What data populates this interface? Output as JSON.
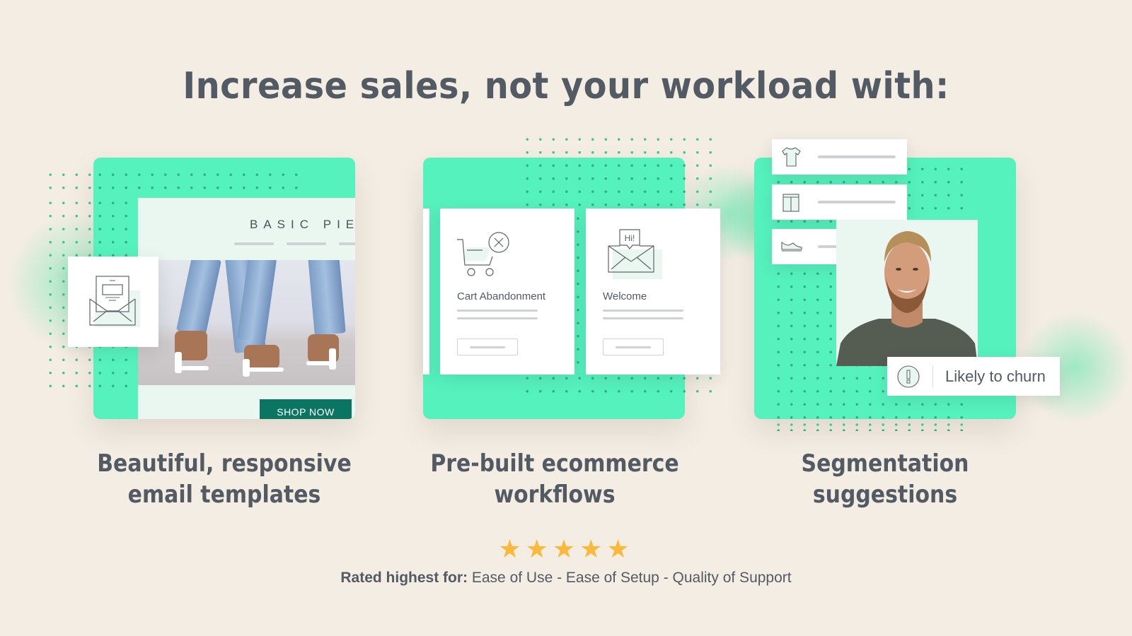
{
  "headline": "Increase sales, not your workload with:",
  "colors": {
    "background": "#f4ede3",
    "panel_green": "#55f2be",
    "text": "#525a64",
    "shop_button": "#0b7563",
    "star": "#fbb93c"
  },
  "features": [
    {
      "label_line1": "Beautiful, responsive",
      "label_line2": "email templates",
      "illustration": {
        "brand_text": "BASIC PIEC",
        "cta_label": "SHOP NOW",
        "icon": "open-envelope-icon"
      }
    },
    {
      "label_line1": "Pre-built ecommerce",
      "label_line2": "workflows",
      "illustration": {
        "cards": [
          {
            "title": "Cart Abandonment",
            "icon": "cart-remove-icon"
          },
          {
            "title": "Welcome",
            "icon": "envelope-hi-icon",
            "bubble": "Hi!"
          }
        ]
      }
    },
    {
      "label_line1": "Segmentation",
      "label_line2": "suggestions",
      "illustration": {
        "categories": [
          "tshirt-icon",
          "shorts-icon",
          "sneaker-icon"
        ],
        "badge_text": "Likely to churn",
        "badge_icon": "alert-circle-icon"
      }
    }
  ],
  "rating": {
    "stars": 5,
    "max_stars": 5,
    "star_glyph": "★★★★★",
    "prefix": "Rated highest for:",
    "items": "Ease of Use - Ease of Setup - Quality of Support"
  }
}
